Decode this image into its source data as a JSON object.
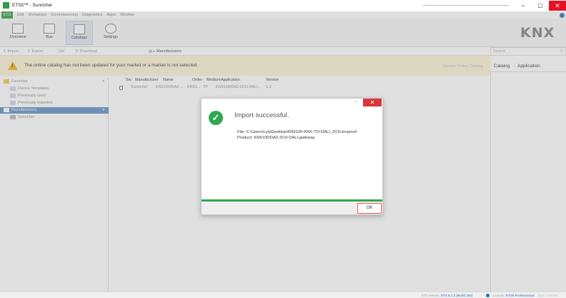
{
  "window": {
    "title": "ETS5™ - Sunricher",
    "min_glyph": "−",
    "max_glyph": "▢",
    "close_glyph": "✕"
  },
  "menu": {
    "ets_label": "ETS",
    "items": [
      "Edit",
      "Workplace",
      "Commissioning",
      "Diagnostics",
      "Apps",
      "Window"
    ]
  },
  "ribbon": {
    "buttons": [
      {
        "label": "Overview"
      },
      {
        "label": "Bus"
      },
      {
        "label": "Catalogs"
      },
      {
        "label": "Settings"
      }
    ],
    "logo": "KNX"
  },
  "toolbar": {
    "import_label": "Import",
    "export_label": "Export",
    "delete_label": "Del",
    "download_label": "Download",
    "breadcrumb": "Manufacturers",
    "search_placeholder": "Search"
  },
  "banner": {
    "message": "The online catalog has not been updated for your market or a market is not selected.",
    "button_label": "Update Online Catalog"
  },
  "right_panel": {
    "tabs": [
      "Catalog",
      "Application"
    ]
  },
  "tree": {
    "items": [
      {
        "label": "Favorites",
        "kind": "fav"
      },
      {
        "label": "Device Templates",
        "kind": "sub"
      },
      {
        "label": "Previously used",
        "kind": "sub"
      },
      {
        "label": "Previously imported",
        "kind": "sub"
      },
      {
        "label": "Manufacturers",
        "kind": "sel"
      },
      {
        "label": "Sunricher",
        "kind": "child"
      }
    ]
  },
  "grid": {
    "headers": [
      "Sw",
      "Manufacturer",
      "Name",
      "Order",
      "Medium",
      "Application",
      "Version"
    ],
    "row": [
      "",
      "Sunricher",
      "KN9100/DA2-...",
      "KN91...",
      "TP",
      "KN9100/DA2-2CH DALI...",
      "1.2"
    ]
  },
  "dialog": {
    "title": "Import successful.",
    "file_line": "File: C:\\Users\\Lyq\\Desktop\\KN9100-KNX-TO-DALI_2CH.knxprod",
    "product_line": "Product: KN9100/DA2-2CH DALI-gateway",
    "ok_label": "OK",
    "min_glyph": "▫",
    "close_glyph": "✕",
    "check_glyph": "✓",
    "accent": "#2fa84f"
  },
  "status": {
    "version_prefix": "ETS version:",
    "version_value": "ETS 5.7.2 (Build 160)",
    "license_prefix": "License:",
    "license_value": "ETS5 Professional",
    "apps_text": "Apps: 0 active"
  }
}
